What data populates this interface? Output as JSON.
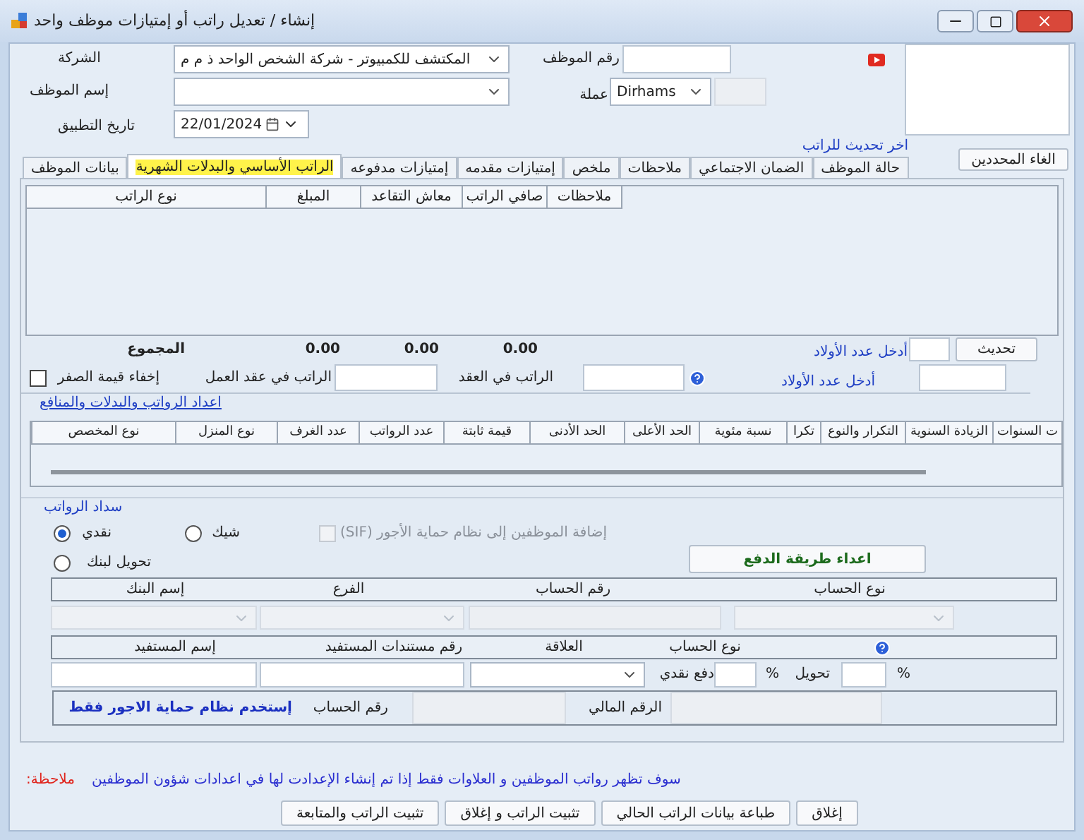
{
  "window": {
    "title": "إنشاء / تعديل راتب أو إمتيازات موظف واحد"
  },
  "header": {
    "company_label": "الشركة",
    "company": "المكتشف للكمبيوتر - شركة الشخص الواحد ذ م م",
    "employee_no_label": "رقم الموظف",
    "employee_name_label": "إسم الموظف",
    "currency_label": "عملة",
    "currency": "Dirhams",
    "date_label": "تاريخ التطبيق",
    "date": "22/01/2024",
    "last_update_link": "اخر تحديث للراتب",
    "clear_button": "الغاء المحددين"
  },
  "tabs": [
    {
      "label": "حالة الموظف",
      "selected": false
    },
    {
      "label": "الضمان الاجتماعي",
      "selected": false
    },
    {
      "label": "ملاحظات",
      "selected": false
    },
    {
      "label": "ملخص",
      "selected": false
    },
    {
      "label": "إمتيازات مقدمه",
      "selected": false
    },
    {
      "label": "إمتيازات مدفوعه",
      "selected": false
    },
    {
      "label": "الراتب الأساسي والبدلات الشهرية",
      "selected": true
    },
    {
      "label": "بيانات الموظف",
      "selected": false
    }
  ],
  "salary_grid": {
    "columns": [
      "ملاحظات",
      "صافي الراتب",
      "معاش التقاعد",
      "المبلغ",
      "نوع الراتب"
    ]
  },
  "totals": {
    "label": "المجموع",
    "values": [
      "0.00",
      "0.00",
      "0.00"
    ]
  },
  "children": {
    "link": "أدخل عدد الأولاد",
    "update_button": "تحديث",
    "second_link": "أدخل عدد الأولاد"
  },
  "hide_zero": {
    "label": "إخفاء قيمة الصفر",
    "checked": false
  },
  "work_contract_salary_label": "الراتب في عقد العمل",
  "contract_salary_label": "الراتب في العقد",
  "settings_link": "اعداد الرواتب والبدلات والمنافع",
  "benefits_grid": {
    "columns": [
      "ت السنوات",
      "الزيادة السنوية",
      "التكرار والنوع",
      "تكرا",
      "نسبة مئوية",
      "الحد الأعلى",
      "الحد الأدنى",
      "قيمة ثابتة",
      "عدد الرواتب",
      "عدد الغرف",
      "نوع المنزل",
      "نوع المخصص"
    ]
  },
  "payment": {
    "title": "سداد الرواتب",
    "methods": [
      {
        "label": "نقدي",
        "selected": true
      },
      {
        "label": "شيك",
        "selected": false
      },
      {
        "label": "تحويل لبنك",
        "selected": false
      }
    ],
    "sif": {
      "label": "إضافة الموظفين إلى نظام حماية الأجور (SIF)",
      "checked": false,
      "disabled": true
    },
    "setup_button": "اعداء طريقة الدفع",
    "bank_columns": [
      "نوع الحساب",
      "رقم الحساب",
      "الفرع",
      "إسم البنك"
    ],
    "beneficiary_columns": [
      "نوع الحساب",
      "العلاقة",
      "رقم مستندات المستفيد",
      "إسم المستفيد"
    ],
    "cash_label": "دفع نقدي",
    "transfer_label": "تحويل",
    "percent_signs": [
      "%",
      "%"
    ],
    "wps": {
      "label": "إستخدم نظام حماية الاجور فقط",
      "account_label": "رقم الحساب",
      "financial_no_label": "الرقم المالي"
    }
  },
  "note": {
    "label": "ملاحظة:",
    "text": "سوف تظهر رواتب الموظفين و العلاوات فقط إذا تم إنشاء الإعدادت لها في اعدادات شؤون الموظفين"
  },
  "buttons": [
    "إغلاق",
    "طباعة بيانات الراتب الحالي",
    "تثبيت الراتب و إغلاق",
    "تثبيت الراتب والمتابعة"
  ]
}
